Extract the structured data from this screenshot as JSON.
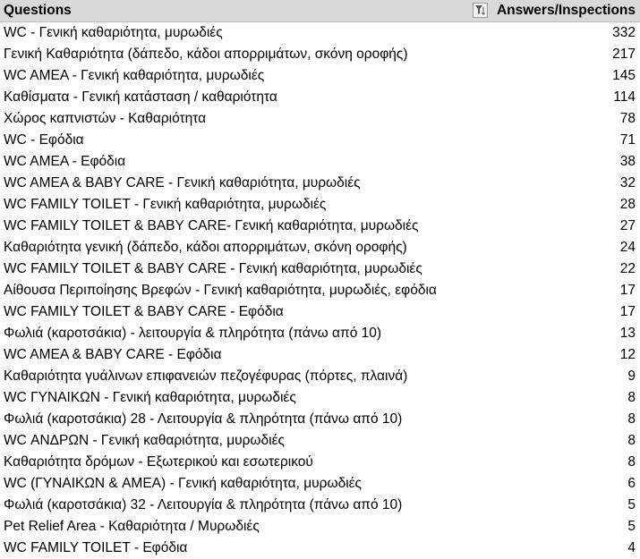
{
  "header": {
    "questions_label": "Questions",
    "answers_label": "Answers/Inspections",
    "filter_icon": "filter-sort-icon"
  },
  "rows": [
    {
      "question": "WC - Γενική καθαριότητα, μυρωδιές",
      "count": "332"
    },
    {
      "question": "Γενική Καθαριότητα (δάπεδο, κάδοι απορριμάτων, σκόνη οροφής)",
      "count": "217"
    },
    {
      "question": "WC AMEA - Γενική καθαριότητα, μυρωδιές",
      "count": "145"
    },
    {
      "question": "Καθίσματα - Γενική κατάσταση / καθαριότητα",
      "count": "114"
    },
    {
      "question": "Χώρος καπνιστών - Καθαριότητα",
      "count": "78"
    },
    {
      "question": "WC - Εφόδια",
      "count": "71"
    },
    {
      "question": "WC AMEA - Εφόδια",
      "count": "38"
    },
    {
      "question": "WC AMEA & BABY CARE - Γενική καθαριότητα, μυρωδιές",
      "count": "32"
    },
    {
      "question": "WC FAMILY TOILET - Γενική καθαριότητα, μυρωδιές",
      "count": "28"
    },
    {
      "question": "WC FAMILY TOILET & BABY CARE- Γενική καθαριότητα, μυρωδιές",
      "count": "27"
    },
    {
      "question": "Καθαριότητα γενική (δάπεδο, κάδοι απορριμάτων, σκόνη οροφής)",
      "count": "24"
    },
    {
      "question": "WC FAMILY TOILET & BABY CARE - Γενική καθαριότητα, μυρωδιές",
      "count": "22"
    },
    {
      "question": "Αίθουσα Περιποίησης Βρεφών - Γενική καθαριότητα, μυρωδιές, εφόδια",
      "count": "17"
    },
    {
      "question": "WC FAMILY TOILET & BABY CARE - Εφόδια",
      "count": "17"
    },
    {
      "question": "Φωλιά (καροτσάκια)  - λειτουργία & πληρότητα (πάνω από 10)",
      "count": "13"
    },
    {
      "question": "WC AMEA & BABY CARE - Εφόδια",
      "count": "12"
    },
    {
      "question": "Καθαριότητα γυάλινων επιφανειών πεζογέφυρας (πόρτες, πλαινά)",
      "count": "9"
    },
    {
      "question": "WC ΓΥΝΑΙΚΩΝ - Γενική καθαριότητα, μυρωδιές",
      "count": "8"
    },
    {
      "question": "Φωλιά (καροτσάκια) 28 - Λειτουργία & πληρότητα (πάνω από 10)",
      "count": "8"
    },
    {
      "question": "WC ΑΝΔΡΩΝ - Γενική καθαριότητα, μυρωδιές",
      "count": "8"
    },
    {
      "question": "Καθαριότητα δρόμων - Εξωτερικού  και εσωτερικού",
      "count": "8"
    },
    {
      "question": "WC (ΓΥΝΑΙΚΩΝ & AMEA) - Γενική καθαριότητα, μυρωδιές",
      "count": "6"
    },
    {
      "question": "Φωλιά (καροτσάκια) 32 - Λειτουργία & πληρότητα (πάνω από 10)",
      "count": "5"
    },
    {
      "question": "Pet Relief Area - Καθαριότητα / Μυρωδιές",
      "count": "5"
    },
    {
      "question": "WC FAMILY TOILET - Εφόδια",
      "count": "4"
    }
  ]
}
